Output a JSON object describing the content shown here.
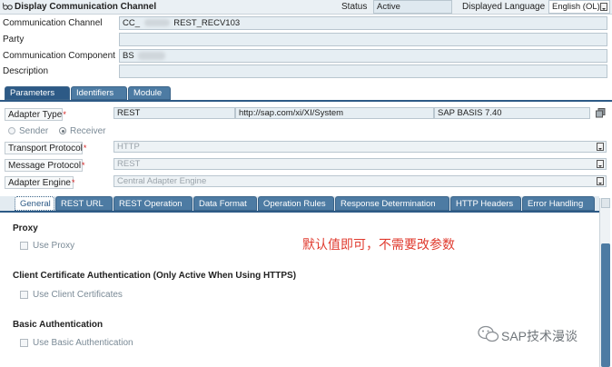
{
  "header": {
    "title": "Display Communication Channel",
    "status_label": "Status",
    "status_value": "Active",
    "lang_label": "Displayed Language",
    "lang_value": "English (OL)"
  },
  "fields": {
    "channel_label": "Communication Channel",
    "channel_prefix": "CC_",
    "channel_suffix": "REST_RECV103",
    "party_label": "Party",
    "component_label": "Communication Component",
    "component_value": "BS",
    "description_label": "Description"
  },
  "top_tabs": [
    "Parameters",
    "Identifiers",
    "Module"
  ],
  "adapter": {
    "type_label": "Adapter Type",
    "type_value": "REST",
    "namespace": "http://sap.com/xi/XI/System",
    "release": "SAP BASIS 7.40",
    "sender_label": "Sender",
    "receiver_label": "Receiver",
    "transport_label": "Transport Protocol",
    "transport_value": "HTTP",
    "message_label": "Message Protocol",
    "message_value": "REST",
    "engine_label": "Adapter Engine",
    "engine_value": "Central Adapter Engine",
    "required_mark": "*"
  },
  "sub_tabs": [
    "General",
    "REST URL",
    "REST Operation",
    "Data Format",
    "Operation Rules",
    "Response Determination",
    "HTTP Headers",
    "Error Handling"
  ],
  "general": {
    "proxy_title": "Proxy",
    "use_proxy": "Use Proxy",
    "cert_title": "Client Certificate Authentication (Only Active When Using HTTPS)",
    "use_cert": "Use Client Certificates",
    "basic_title": "Basic Authentication",
    "use_basic": "Use Basic Authentication"
  },
  "annotation": "默认值即可，不需要改参数",
  "watermark": "SAP技术漫谈"
}
